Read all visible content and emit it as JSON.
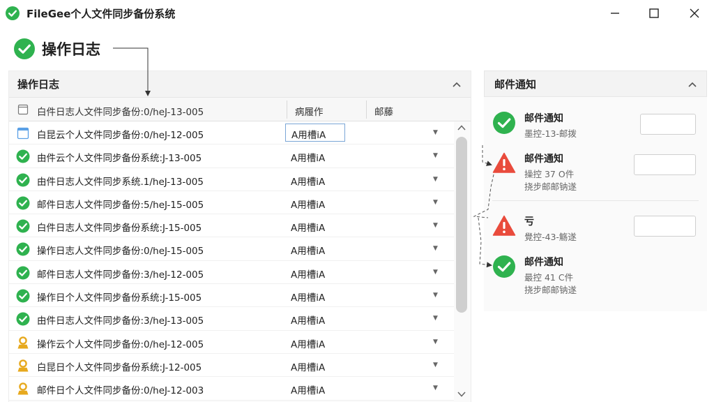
{
  "window": {
    "title": "FileGee个人文件同步备份系统",
    "controls": {
      "minimize": "minimize",
      "maximize": "maximize",
      "close": "close"
    }
  },
  "heading": {
    "text": "操作日志"
  },
  "log_panel": {
    "title": "操作日志",
    "columns": [
      "白件日志人文件同步备份:0/heJ-13-005",
      "病履作",
      "邮藤"
    ],
    "rows": [
      {
        "status": "file-blue",
        "name": "白昆云个人文件同步备份:0/heJ-12-005",
        "owner": "A用槽iA",
        "selected": true
      },
      {
        "status": "success",
        "name": "由件云个人文件同步备份系统:J-13-005",
        "owner": "A用槽iA"
      },
      {
        "status": "success",
        "name": "由件日志人文件同步系统.1/heJ-13-005",
        "owner": "A用槽iA"
      },
      {
        "status": "success",
        "name": "邮件日志人文件同步备份:5/heJ-15-005",
        "owner": "A用槽iA"
      },
      {
        "status": "success",
        "name": "白件日志人文件同步备份系统:J-15-005",
        "owner": "A用槽iA"
      },
      {
        "status": "success",
        "name": "操作日志人文件同步备份:0/heJ-15-005",
        "owner": "A用槽iA"
      },
      {
        "status": "success",
        "name": "邮件日志人文件同步备份:3/heJ-12-005",
        "owner": "A用槽iA"
      },
      {
        "status": "success",
        "name": "操作日个人文件同步备份系统:J-15-005",
        "owner": "A用槽iA"
      },
      {
        "status": "success",
        "name": "由件日志人文件同步备份:3/heJ-13-005",
        "owner": "A用槽iA"
      },
      {
        "status": "warning-user",
        "name": "操作云个人文件同步备份:0/heJ-12-005",
        "owner": "A用槽iA"
      },
      {
        "status": "warning-user",
        "name": "白昆日个人文件同步备份系统:J-12-005",
        "owner": "A用槽iA"
      },
      {
        "status": "warning-user",
        "name": "邮件日个人文件同步备份:0/heJ-12-003",
        "owner": "A用槽iA"
      }
    ]
  },
  "mail_panel": {
    "title": "邮件通知",
    "notices": [
      {
        "icon": "check-circle",
        "title": "邮件通知",
        "lines": [
          "墨控-13-邮拨"
        ]
      },
      {
        "icon": "warning-triangle",
        "title": "邮件通知",
        "lines": [
          "操控 37 O件",
          "挠步邮邮钠遂"
        ]
      },
      {
        "icon": "warning-triangle",
        "title": "亏",
        "lines": [
          "覺控-43-觞遂"
        ]
      },
      {
        "icon": "check-circle",
        "title": "邮件通知",
        "lines": [
          "最控 41 C件",
          "挠步邮邮钠遂"
        ]
      }
    ]
  },
  "colors": {
    "success": "#2fb24f",
    "warning": "#e94b3c",
    "user_gold": "#e7a91e",
    "file_blue": "#5aa0e6"
  }
}
